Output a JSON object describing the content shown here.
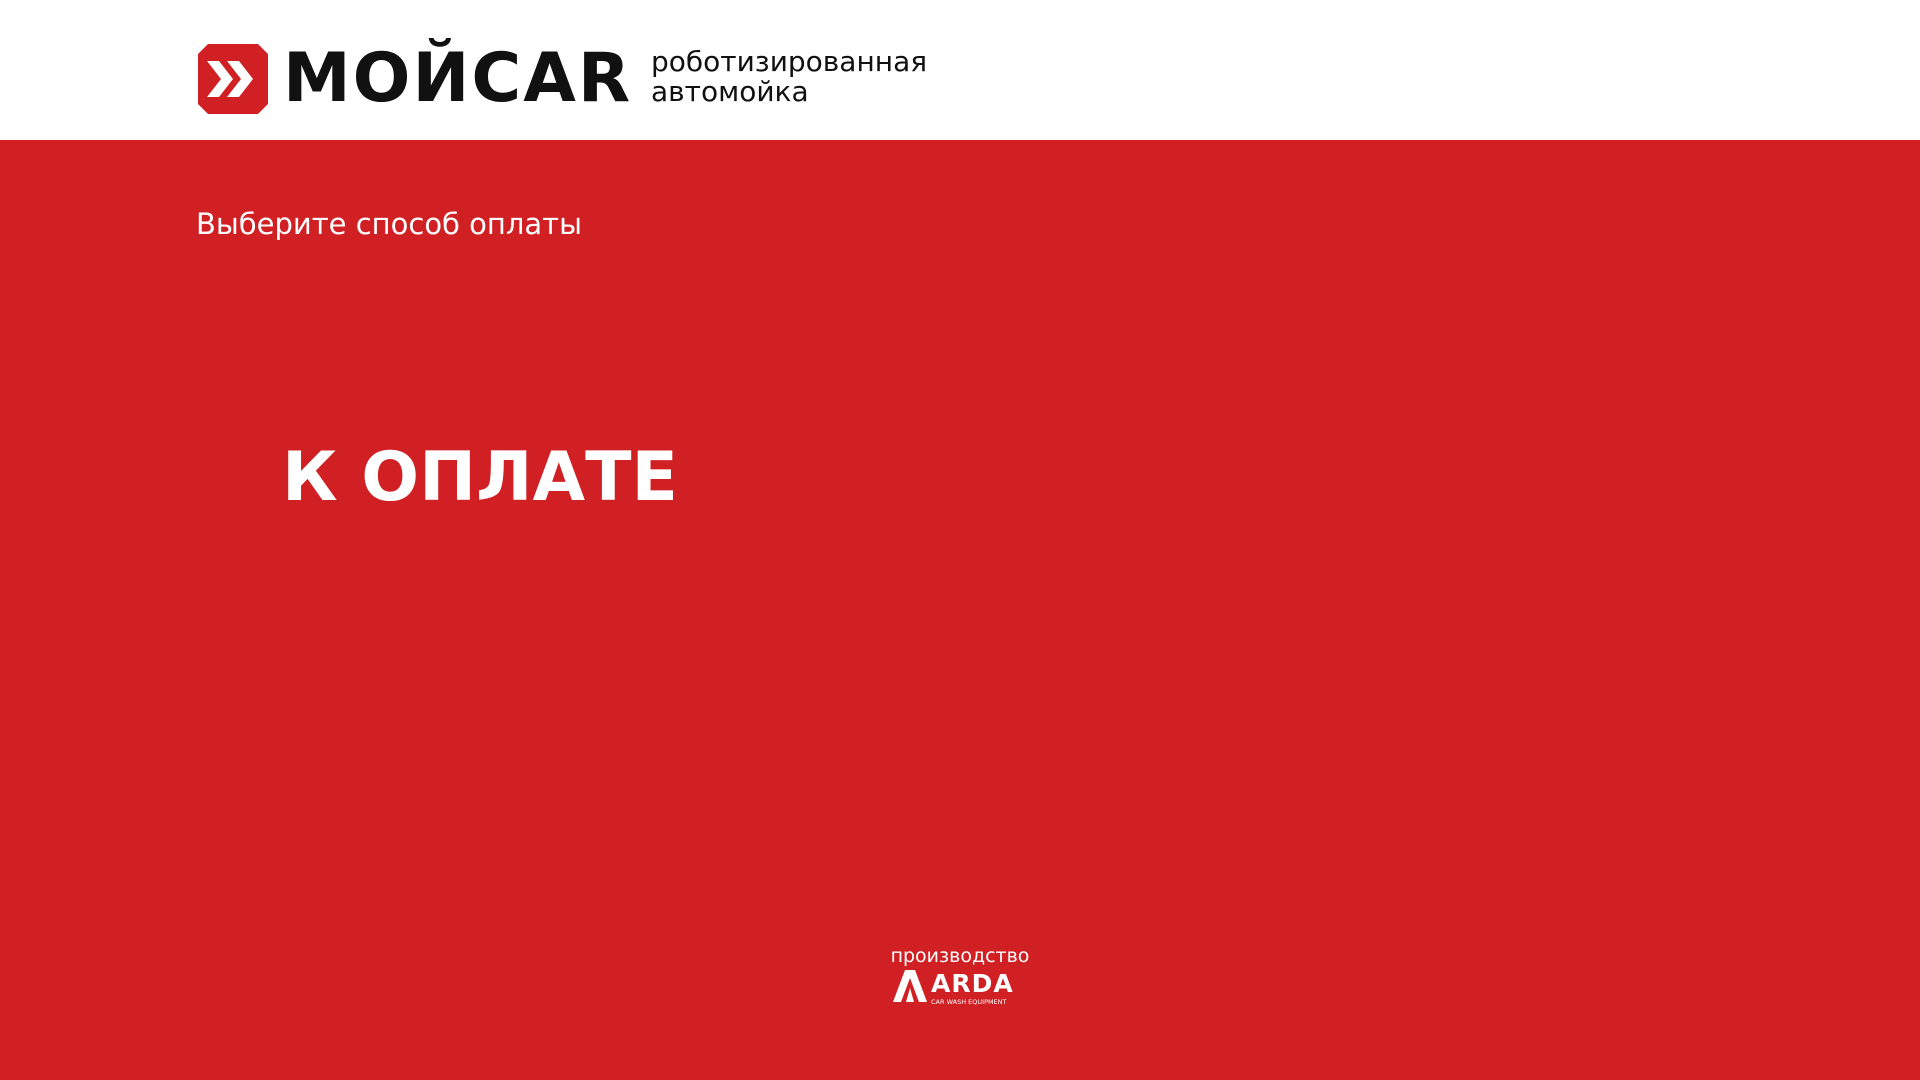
{
  "header": {
    "logo": {
      "icon": "double-chevron-right-icon",
      "wordmark": "МОЙCAR",
      "tagline_line1": "роботизированная",
      "tagline_line2": "автомойка"
    }
  },
  "main": {
    "subtitle": "Выберите способ оплаты",
    "amount_label": "К ОПЛАТЕ"
  },
  "footer": {
    "caption": "производство",
    "manufacturer_logo": {
      "icon": "arda-logo-icon",
      "name": "ARDA",
      "tagline": "CAR WASH EQUIPMENT"
    }
  },
  "colors": {
    "brand_red": "#d12024",
    "header_background": "#ffffff",
    "text_dark": "#111111",
    "text_light": "#ffffff"
  }
}
